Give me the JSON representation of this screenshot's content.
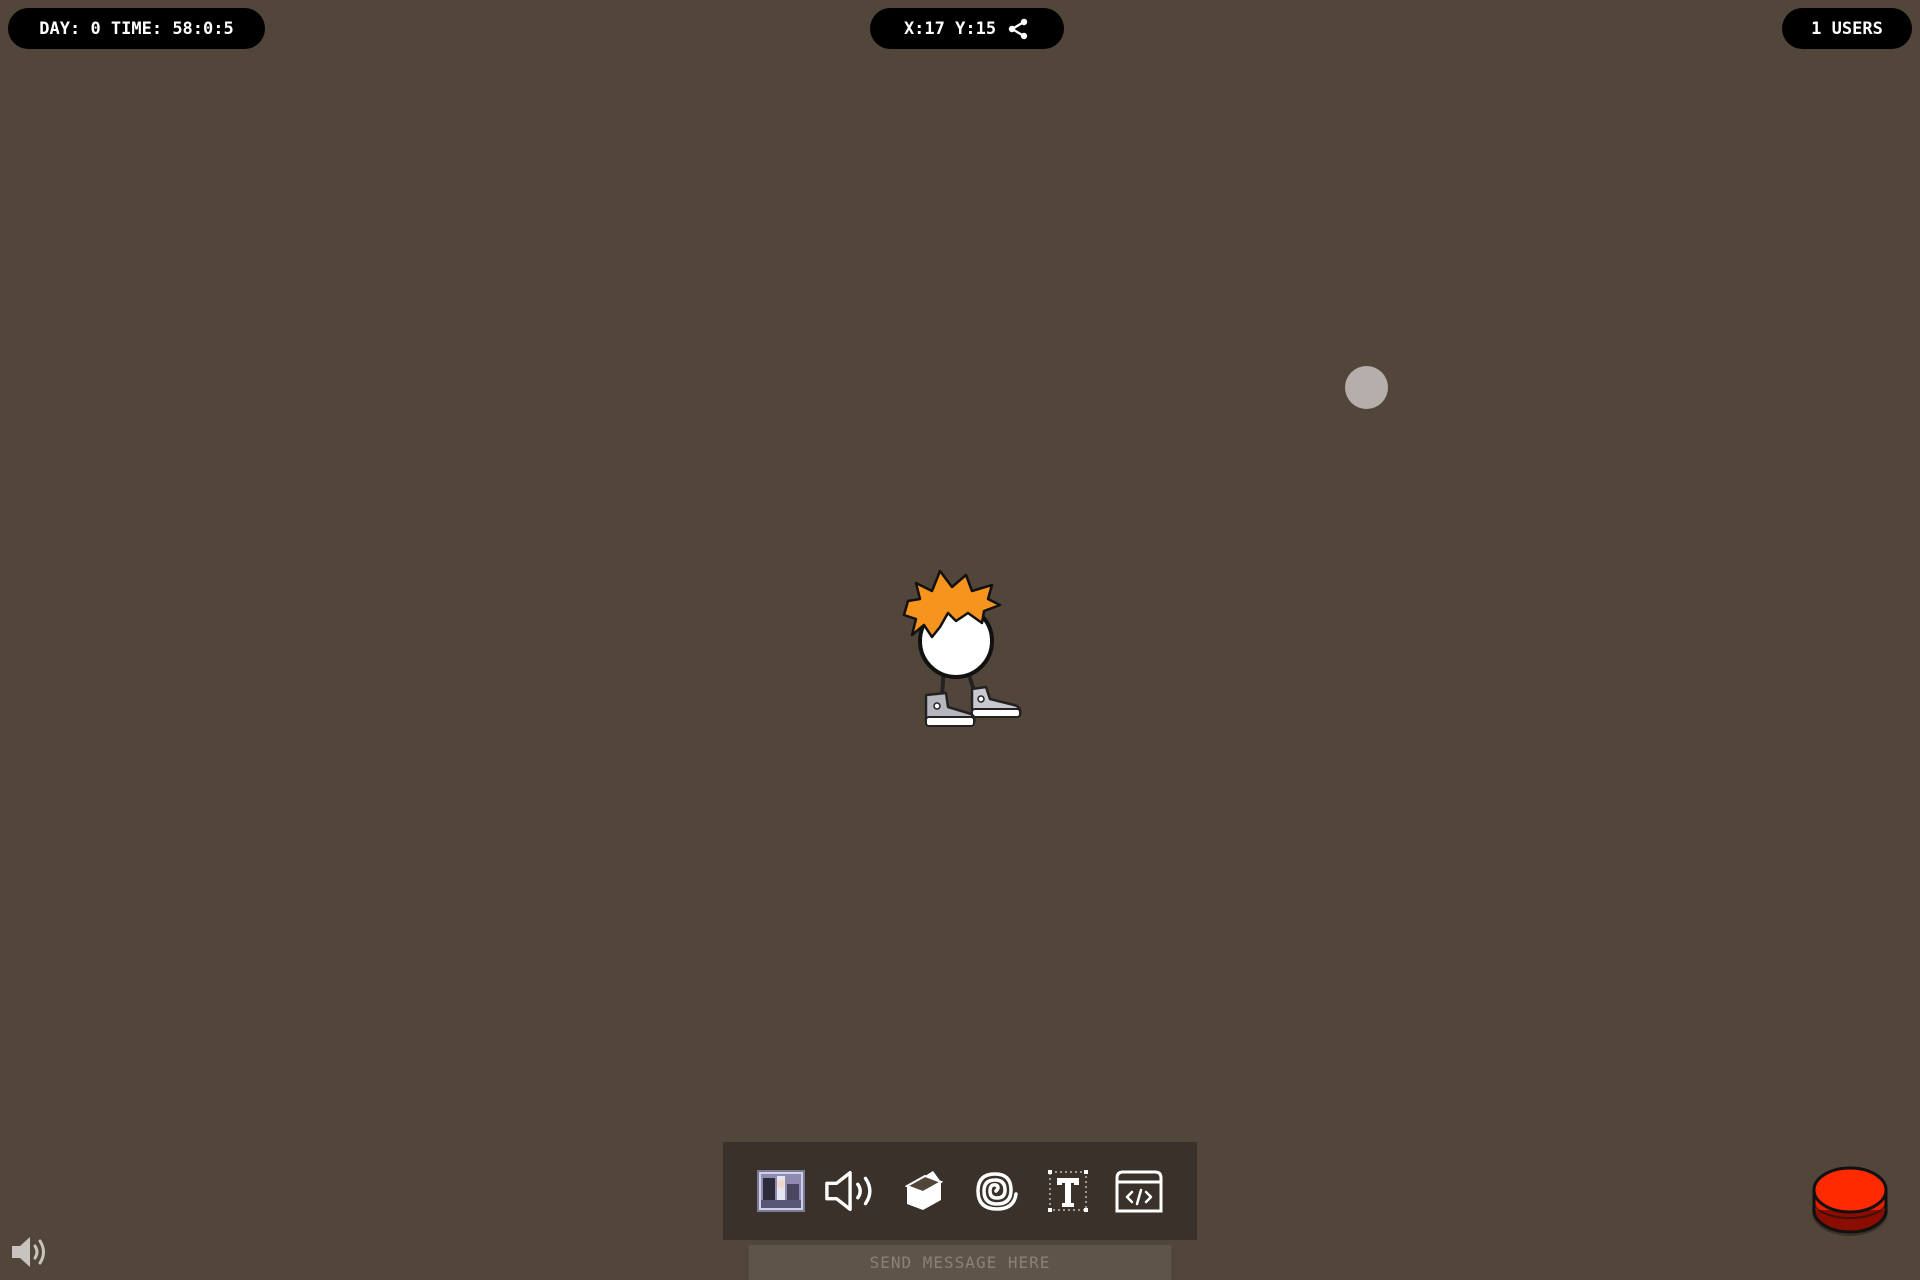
{
  "status": {
    "time_label": "DAY: 0 TIME: 58:0:5",
    "coords_label": "X:17 Y:15",
    "users_label": "1 USERS"
  },
  "toolbar": {
    "items": [
      {
        "name": "image-tool",
        "icon": "thumbnail-image-icon"
      },
      {
        "name": "audio-tool",
        "icon": "speaker-icon"
      },
      {
        "name": "object-tool",
        "icon": "block-icon"
      },
      {
        "name": "portal-tool",
        "icon": "spiral-icon"
      },
      {
        "name": "text-tool",
        "icon": "text-t-icon"
      },
      {
        "name": "embed-tool",
        "icon": "code-window-icon"
      }
    ]
  },
  "chat": {
    "placeholder": "SEND MESSAGE HERE"
  },
  "colors": {
    "background": "#52463a",
    "pill": "#000000",
    "toolbar": "#3a322a",
    "hair": "#f7941d",
    "record": "#ff2a00"
  }
}
